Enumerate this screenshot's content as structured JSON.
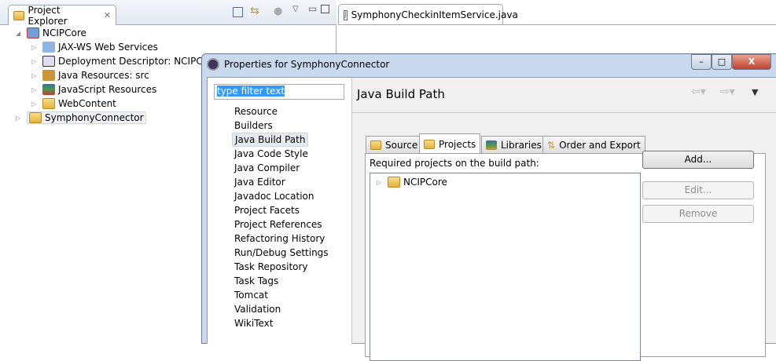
{
  "project_explorer": {
    "title": "Project Explorer",
    "tree": [
      {
        "label": "NCIPCore",
        "expanded": true,
        "level": 0
      },
      {
        "label": "JAX-WS Web Services",
        "level": 1
      },
      {
        "label": "Deployment Descriptor: NCIPCore",
        "level": 1
      },
      {
        "label": "Java Resources: src",
        "level": 1
      },
      {
        "label": "JavaScript Resources",
        "level": 1
      },
      {
        "label": "WebContent",
        "level": 1
      },
      {
        "label": "SymphonyConnector",
        "level": 0,
        "selected": true
      }
    ]
  },
  "editor": {
    "tab": "SymphonyCheckinItemService.java"
  },
  "dialog": {
    "title": "Properties for SymphonyConnector",
    "filter_value": "type filter text",
    "nav": [
      "Resource",
      "Builders",
      "Java Build Path",
      "Java Code Style",
      "Java Compiler",
      "Java Editor",
      "Javadoc Location",
      "Project Facets",
      "Project References",
      "Refactoring History",
      "Run/Debug Settings",
      "Task Repository",
      "Task Tags",
      "Tomcat",
      "Validation",
      "WikiText"
    ],
    "page_title": "Java Build Path",
    "tabs": [
      "Source",
      "Projects",
      "Libraries",
      "Order and Export"
    ],
    "active_tab": "Projects",
    "required_label": "Required projects on the build path:",
    "projects": [
      "NCIPCore"
    ],
    "buttons": {
      "add": "Add...",
      "edit": "Edit...",
      "remove": "Remove"
    },
    "window": {
      "min": "–",
      "max": "□",
      "close": "X"
    }
  }
}
